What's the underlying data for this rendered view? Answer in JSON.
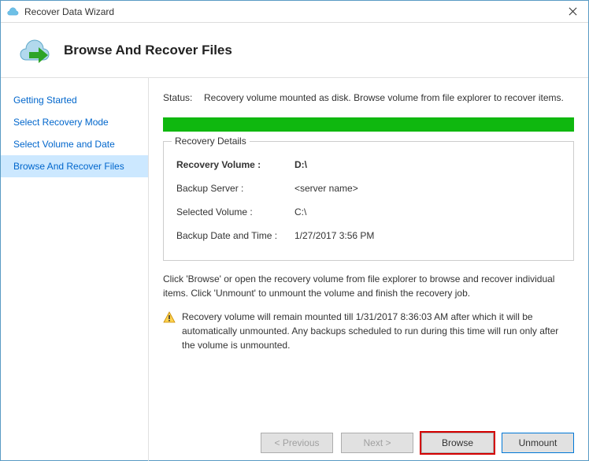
{
  "window": {
    "title": "Recover Data Wizard"
  },
  "header": {
    "title": "Browse And Recover Files"
  },
  "sidebar": {
    "items": [
      {
        "label": "Getting Started"
      },
      {
        "label": "Select Recovery Mode"
      },
      {
        "label": "Select Volume and Date"
      },
      {
        "label": "Browse And Recover Files"
      }
    ]
  },
  "content": {
    "status_label": "Status:",
    "status_text": "Recovery volume mounted as disk. Browse volume from file explorer to recover items.",
    "details_title": "Recovery Details",
    "details": {
      "recovery_volume_key": "Recovery Volume  :",
      "recovery_volume_val": "D:\\",
      "backup_server_key": "Backup Server :",
      "backup_server_val": "<server name>",
      "selected_volume_key": "Selected Volume :",
      "selected_volume_val": "C:\\",
      "backup_datetime_key": "Backup Date and Time :",
      "backup_datetime_val": "1/27/2017 3:56 PM"
    },
    "info": "Click 'Browse' or open the recovery volume from file explorer to browse and recover individual items. Click 'Unmount' to unmount the volume and finish the recovery job.",
    "warning": "Recovery volume will remain mounted till 1/31/2017 8:36:03 AM after which it will be automatically unmounted. Any backups scheduled to run during this time will run only after the volume is unmounted."
  },
  "buttons": {
    "previous": "< Previous",
    "next": "Next >",
    "browse": "Browse",
    "unmount": "Unmount"
  }
}
